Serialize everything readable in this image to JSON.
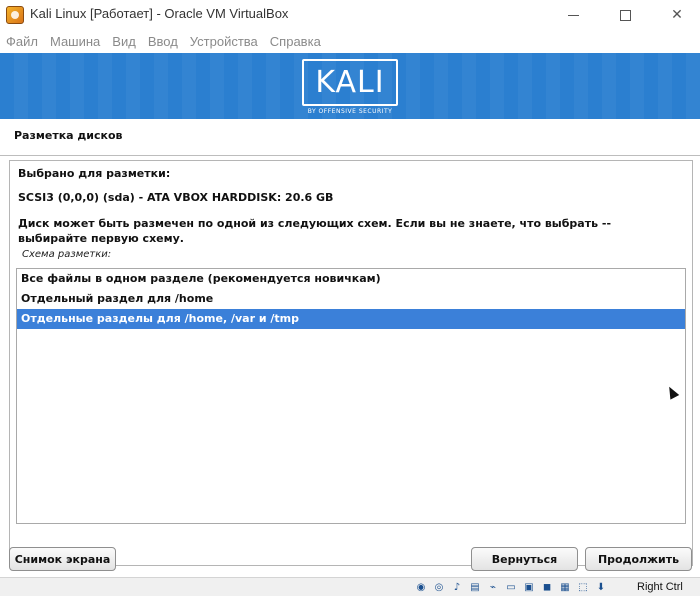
{
  "window": {
    "title": "Kali Linux [Работает] - Oracle VM VirtualBox",
    "controls": {
      "minimize": "—",
      "maximize": "☐",
      "close": "✕"
    }
  },
  "menu": {
    "items": [
      "Файл",
      "Машина",
      "Вид",
      "Ввод",
      "Устройства",
      "Справка"
    ]
  },
  "banner": {
    "logo": "KALI",
    "tagline": "BY OFFENSIVE SECURITY",
    "color": "#2b7fd0"
  },
  "installer": {
    "page_title": "Разметка дисков",
    "selected_label": "Выбрано для разметки:",
    "disk": "SCSI3 (0,0,0) (sda) - ATA VBOX HARDDISK: 20.6 GB",
    "description": "Диск может быть размечен по одной из следующих схем. Если вы не знаете, что выбрать -- выбирайте первую схему.",
    "scheme_label": "Схема разметки:",
    "options": [
      "Все файлы в одном разделе (рекомендуется новичкам)",
      "Отдельный раздел для /home",
      "Отдельные разделы для /home, /var и /tmp"
    ],
    "selected_index": 2,
    "selection_color": "#3b80d9"
  },
  "buttons": {
    "screenshot": "Снимок экрана",
    "back": "Вернуться",
    "continue": "Продолжить"
  },
  "statusbar": {
    "icons": [
      "hard-disk-icon",
      "optical-drive-icon",
      "audio-icon",
      "network-icon",
      "usb-icon",
      "shared-folder-icon",
      "display-icon",
      "video-capture-icon",
      "cpu-icon",
      "mouse-integration-icon",
      "keyboard-icon"
    ],
    "host_key": "Right Ctrl"
  }
}
